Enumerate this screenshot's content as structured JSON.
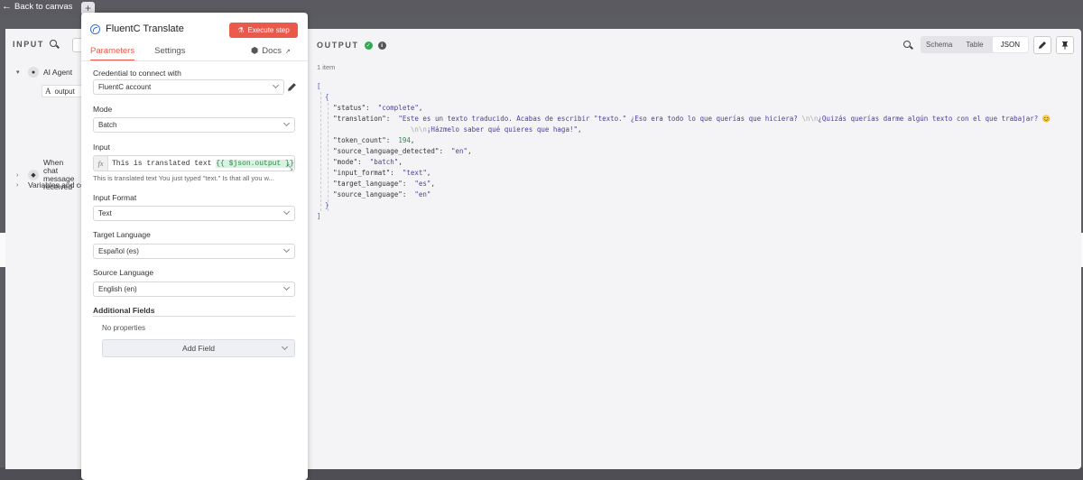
{
  "topbar": {
    "back_label": "Back to canvas",
    "plus_label": "+"
  },
  "input_pane": {
    "title": "INPUT",
    "tree": [
      {
        "label": "AI Agent",
        "chevron": "▾"
      },
      {
        "label": "When chat message received",
        "chevron": "›"
      },
      {
        "label": "Variables and context",
        "chevron": "›"
      }
    ],
    "field_type": "A",
    "field_label": "output"
  },
  "params": {
    "title": "FluentC Translate",
    "execute_label": "Execute step",
    "tabs": [
      "Parameters",
      "Settings"
    ],
    "docs_label": "Docs",
    "credential_label": "Credential to connect with",
    "credential_value": "FluentC account",
    "mode_label": "Mode",
    "mode_value": "Batch",
    "input_label": "Input",
    "input_expr_text": "This is translated text ",
    "input_expr_var": "{{ $json.output }}",
    "input_hint": "This is translated text You just typed \"text.\" Is that all you w...",
    "input_format_label": "Input Format",
    "input_format_value": "Text",
    "target_lang_label": "Target Language",
    "target_lang_value": "Español (es)",
    "source_lang_label": "Source Language",
    "source_lang_value": "English (en)",
    "additional_label": "Additional Fields",
    "no_props": "No properties",
    "add_field_label": "Add Field"
  },
  "output_pane": {
    "title": "OUTPUT",
    "items_count": "1 item",
    "views": [
      "Schema",
      "Table",
      "JSON"
    ],
    "active_view": "JSON"
  },
  "json_output": {
    "status_key": "\"status\":",
    "status_val": "\"complete\"",
    "translation_key": "\"translation\":",
    "translation_val_1": "\"Este es un texto traducido. Acabas de escribir \"texto.\" ¿Eso era todo lo que querías que hiciera? ",
    "translation_esc_1": "\\n\\n",
    "translation_val_2": "¿Quizás querías darme algún texto con el que trabajar? 😊",
    "translation_esc_2": "\\n\\n",
    "translation_val_3": "¡Házmelo saber qué quieres que haga!\"",
    "token_count_key": "\"token_count\":",
    "token_count_val": "194",
    "source_detected_key": "\"source_language_detected\":",
    "source_detected_val": "\"en\"",
    "mode_key": "\"mode\":",
    "mode_val": "\"batch\"",
    "input_format_key": "\"input_format\":",
    "input_format_val": "\"text\"",
    "target_key": "\"target_language\":",
    "target_val": "\"es\"",
    "source_key": "\"source_language\":",
    "source_val": "\"en\""
  },
  "colors": {
    "accent": "#ea5a4c",
    "success": "#2fa84f",
    "brand": "#3a6fd8"
  }
}
